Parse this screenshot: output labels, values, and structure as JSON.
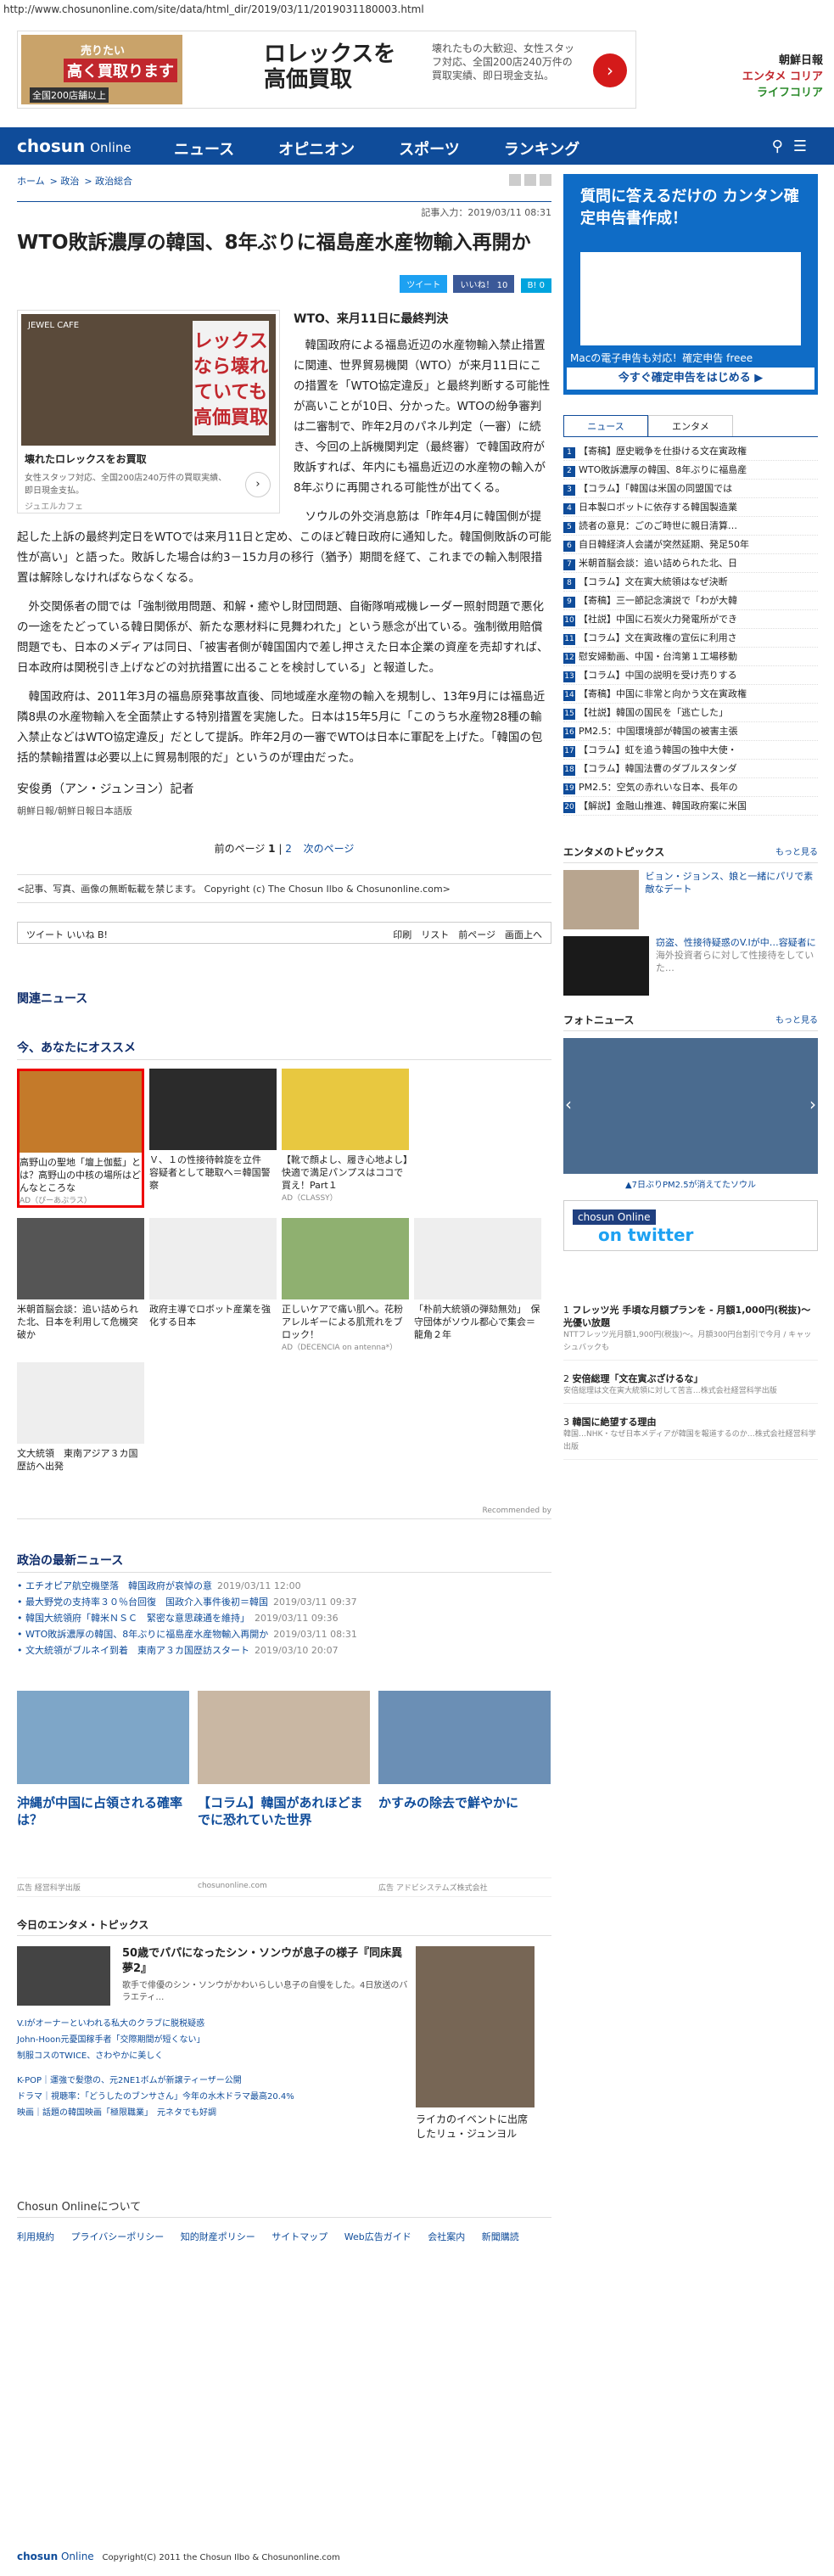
{
  "url": "http://www.chosunonline.com/site/data/html_dir/2019/03/11/2019031180003.html",
  "top_ad": {
    "rolex_line1": "売りたい",
    "rolex_line2": "高く買取ります",
    "rolex_line3": "全国200店舗以上",
    "headline": "ロレックスを高価買取",
    "desc": "壊れたもの大歓迎、女性スタッフ対応、全国200店240万件の買取実績、即日現金支払。"
  },
  "brands": [
    "朝鮮日報",
    "エンタメ コリア",
    "ライフコリア"
  ],
  "nav": {
    "logo": "chosun",
    "logo_sub": "Online",
    "items": [
      "ニュース",
      "オピニオン",
      "スポーツ",
      "ランキング"
    ]
  },
  "breadcrumb": [
    "ホーム",
    "政治",
    "政治総合"
  ],
  "dateline": "記事入力：2019/03/11 08:31",
  "title": "WTO敗訴濃厚の韓国、8年ぶりに福島産水産物輸入再開か",
  "share": {
    "tweet": "ツイート",
    "like": "いいね！ 10",
    "hatena": "B! 0"
  },
  "photo_ad": {
    "brand": "JEWEL CAFE",
    "badge": "レックスなら壊れていても高価買取",
    "caption": "壊れたロレックスをお買取",
    "desc": "女性スタッフ対応、全国200店240万件の買取実績、即日現金支払。",
    "sponsor": "ジュエルカフェ"
  },
  "subhead": "WTO、来月11日に最終判決",
  "paragraphs": [
    "韓国政府による福島近辺の水産物輸入禁止措置に関連、世界貿易機関（WTO）が来月11日にこの措置を「WTO協定違反」と最終判断する可能性が高いことが10日、分かった。WTOの紛争審判は二審制で、昨年2月のパネル判定（一審）に続き、今回の上訴機関判定（最終審）で韓国政府が敗訴すれば、年内にも福島近辺の水産物の輸入が8年ぶりに再開される可能性が出てくる。",
    "ソウルの外交消息筋は「昨年4月に韓国側が提起した上訴の最終判定日をWTOでは来月11日と定め、このほど韓日政府に通知した。韓国側敗訴の可能性が高い」と語った。敗訴した場合は約3－15カ月の移行（猶予）期間を経て、これまでの輸入制限措置は解除しなければならなくなる。",
    "外交関係者の間では「強制徴用問題、和解・癒やし財団問題、自衛隊哨戒機レーダー照射問題で悪化の一途をたどっている韓日関係が、新たな悪材料に見舞われた」という懸念が出ている。強制徴用賠償問題でも、日本のメディアは同日、「被害者側が韓国国内で差し押さえた日本企業の資産を売却すれば、日本政府は関税引き上げなどの対抗措置に出ることを検討している」と報道した。",
    "韓国政府は、2011年3月の福島原発事故直後、同地域産水産物の輸入を規制し、13年9月には福島近隣8県の水産物輸入を全面禁止する特別措置を実施した。日本は15年5月に「このうち水産物28種の輸入禁止などはWTO協定違反」だとして提訴。昨年2月の一審でWTOは日本に軍配を上げた。「韓国の包括的禁輸措置は必要以上に貿易制限的だ」というのが理由だった。"
  ],
  "byline": "安俊勇（アン・ジュンヨン）記者",
  "byline2": "朝鮮日報/朝鮮日報日本語版",
  "pager": {
    "prev": "前のページ",
    "p1": "1",
    "p2": "2",
    "next": "次のページ"
  },
  "copyright_line": "<記事、写真、画像の無断転載を禁じます。 Copyright (c) The Chosun Ilbo & Chosunonline.com>",
  "toolrow": {
    "left": "ツイート  いいね  B!",
    "right": "印刷　リスト　前ページ　画面上へ"
  },
  "related_title": "関連ニュース",
  "recommend_title": "今、あなたにオススメ",
  "recommend": [
    {
      "text": "高野山の聖地「壇上伽藍」とは？高野山の中核の場所はどんなところな",
      "sponsor": "AD（ぴーあぷラス）"
    },
    {
      "text": "Ｖ、１の性接待斡旋を立件　容疑者として聴取へ＝韓国警察",
      "sponsor": ""
    },
    {
      "text": "【靴で顔よし、履き心地よし】快適で満足パンプスはココで買え！Part１",
      "sponsor": "AD（CLASSY）"
    },
    {
      "text": "米朝首脳会談：追い詰められた北、日本を利用して危機突破か",
      "sponsor": ""
    },
    {
      "text": "政府主導でロボット産業を強化する日本",
      "sponsor": ""
    },
    {
      "text": "正しいケアで痛い肌へ。花粉アレルギーによる肌荒れをブロック！",
      "sponsor": "AD（DECENCIA on antenna*）"
    },
    {
      "text": "「朴前大統領の弾劾無効」　保守団体がソウル都心で集会＝龍角２年",
      "sponsor": ""
    },
    {
      "text": "文大統領　東南アジア３カ国歴訪へ出発",
      "sponsor": ""
    }
  ],
  "recommended_by": "Recommended by",
  "politics_title": "政治の最新ニュース",
  "politics": [
    {
      "t": "エチオピア航空機墜落　韓国政府が哀悼の意",
      "d": "2019/03/11 12:00"
    },
    {
      "t": "最大野党の支持率３０％台回復　国政介入事件後初＝韓国",
      "d": "2019/03/11 09:37"
    },
    {
      "t": "韓国大統領府「韓米ＮＳＣ　緊密な意思疎通を維持」",
      "d": "2019/03/11 09:36"
    },
    {
      "t": "WTO敗訴濃厚の韓国、8年ぶりに福島産水産物輸入再開か",
      "d": "2019/03/11 08:31"
    },
    {
      "t": "文大統領がブルネイ到着　東南ア３カ国歴訪スタート",
      "d": "2019/03/10 20:07"
    }
  ],
  "big_ads": [
    {
      "t": "沖縄が中国に占領される確率は？"
    },
    {
      "t": "【コラム】韓国があれほどまでに恐れていた世界"
    },
    {
      "t": "かすみの除去で鮮やかに"
    }
  ],
  "big_ads_src": [
    "広告 経営科学出版",
    "chosunonline.com",
    "広告 アドビシステムズ株式会社"
  ],
  "ent_title": "今日のエンタメ・トピックス",
  "ent_main": {
    "t": "50歳でパパになったシン・ソンウが息子の様子『同床異夢2』",
    "d": "歌手で俳優のシン・ソンウがかわいらしい息子の自慢をした。4日放送のバラエティ…"
  },
  "ent_list": [
    "V.Iがオーナーといわれる私大のクラブに脱税疑惑",
    "John-Hoon元憂国稼手者「交際期間が短くない」",
    "制服コスのTWICE、さわやかに美しく",
    "K-POP｜運強で髪懲の、元2NE1ボムが新譲ティーザー公開",
    "ドラマ｜視聴率：「どうしたのブンサさん」今年の水木ドラマ最高20.4%",
    "映画｜話題の韓国映画「極限職業」　元ネタでも好調"
  ],
  "ent_side": "ライカのイベントに出席したリュ・ジュンヨル",
  "footer_title": "Chosun Onlineについて",
  "footer_links": [
    "利用規約",
    "プライバシーポリシー",
    "知的財産ポリシー",
    "サイトマップ",
    "Web広告ガイド",
    "会社案内",
    "新聞購読"
  ],
  "footer_copy": "Copyright(C) 2011 the Chosun Ilbo & Chosunonline.com",
  "side_ad": {
    "headline": "質問に答えるだけの カンタン確定申告書作成！",
    "foot": "Macの電子申告も対応！確定申告 freee",
    "button": "今すぐ確定申告をはじめる ▶"
  },
  "tabs": [
    "ニュース",
    "エンタメ"
  ],
  "ranking": [
    "【寄稿】歴史戦争を仕掛ける文在寅政権",
    "WTO敗訴濃厚の韓国、8年ぶりに福島産",
    "【コラム】「韓国は米国の同盟国では",
    "日本製ロボットに依存する韓国製造業",
    "読者の意見：ごのご時世に親日清算…",
    "自日韓経済人会議が突然延期、発足50年",
    "米朝首脳会談：追い詰められた北、日",
    "【コラム】文在寅大統領はなぜ決断",
    "【寄稿】三一節記念演説で「わが大韓",
    "【社説】中国に石炭火力発電所ができ",
    "【コラム】文在寅政権の宣伝に利用さ",
    "慰安婦動画、中国・台湾第１工場移動",
    "【コラム】中国の説明を受け売りする",
    "【寄稿】中国に非常と向かう文在寅政権",
    "【社説】韓国の国民を「逃亡した」",
    "PM2.5：中国環境部が韓国の被害主張",
    "【コラム】虹を追う韓国の独中大使・",
    "【コラム】韓国法曹のダブルスタンダ",
    "PM2.5：空気の赤れいな日本、長年の",
    "【解説】金融山推進、韓国政府案に米国"
  ],
  "ent_topics_title": "エンタメのトピックス",
  "ent_topics": [
    {
      "t": "ビョン・ジョンス、娘と一緒にパリで素敵なデート",
      "s": ""
    },
    {
      "t": "窃盗、性接待疑惑のV.Iが中…容疑者に",
      "s": "海外投資者らに対して性接待をしていた…"
    }
  ],
  "photo_news_title": "フォトニュース",
  "photo_news_caption": "▲7日ぶりPM2.5が消えてたソウル",
  "more": "もっと見る",
  "twitter": {
    "a": "chosun Online",
    "b": "on twitter"
  },
  "side_ads": [
    {
      "t": "フレッツ光 手頃な月額プランを - 月額1,000円(税抜)〜光優い放題",
      "s": "NTTフレッツ光月額1,900円(税抜)〜。月額300円台割引で今月 / キャッシュバックも"
    },
    {
      "t": "安倍総理「文在寅ぶざけるな」",
      "s": "安倍総理は文在寅大統領に対して苦言…株式会社経営科学出版"
    },
    {
      "t": "韓国に絶望する理由",
      "s": "韓国…NHK・なぜ日本メディアが韓国を報道するのか…株式会社経営科学出版"
    }
  ]
}
